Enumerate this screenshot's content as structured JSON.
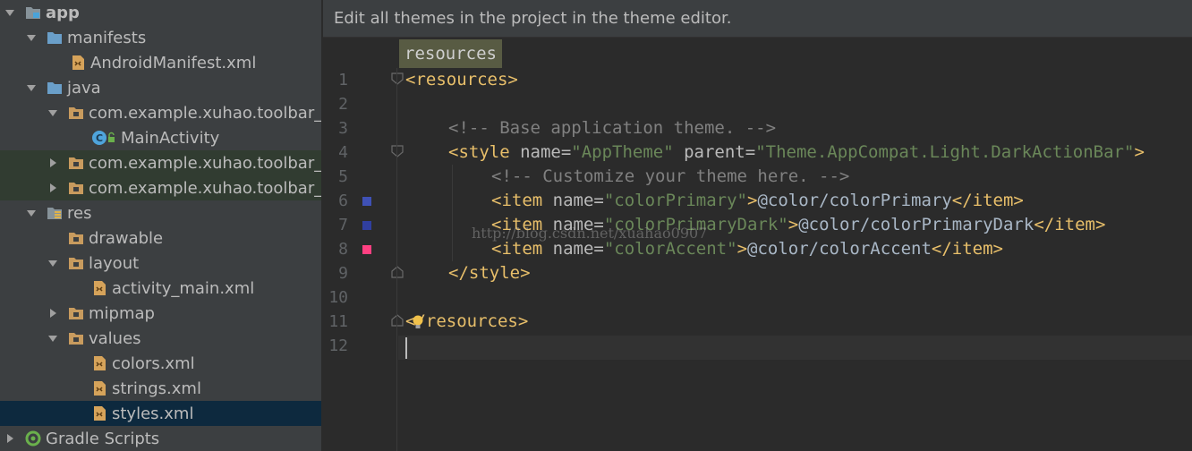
{
  "banner": {
    "text": "Edit all themes in the project in the theme editor."
  },
  "breadcrumb": {
    "label": "resources"
  },
  "tree": {
    "app": "app",
    "manifests": "manifests",
    "android_manifest": "AndroidManifest.xml",
    "java": "java",
    "pkg1": "com.example.xuhao.toolbar_di",
    "main_activity": "MainActivity",
    "pkg2": "com.example.xuhao.toolbar_di",
    "pkg3": "com.example.xuhao.toolbar_di",
    "res": "res",
    "drawable": "drawable",
    "layout": "layout",
    "activity_main": "activity_main.xml",
    "mipmap": "mipmap",
    "values": "values",
    "colors": "colors.xml",
    "strings": "strings.xml",
    "styles": "styles.xml",
    "gradle": "Gradle Scripts"
  },
  "gutter": {
    "numbers": [
      "1",
      "2",
      "3",
      "4",
      "5",
      "6",
      "7",
      "8",
      "9",
      "10",
      "11",
      "12"
    ]
  },
  "code": {
    "l1": {
      "t1": "<resources>"
    },
    "l3": {
      "c": "<!-- Base application theme. -->"
    },
    "l4": {
      "t1": "<style",
      "a1": " name=",
      "v1": "\"AppTheme\"",
      "a2": " parent=",
      "v2": "\"Theme.AppCompat.Light.DarkActionBar\"",
      "t2": ">"
    },
    "l5": {
      "c": "<!-- Customize your theme here. -->"
    },
    "l6": {
      "t1": "<item",
      "a1": " name=",
      "v1": "\"colorPrimary\"",
      "t2": ">",
      "txt": "@color/colorPrimary",
      "t3": "</item>"
    },
    "l7": {
      "t1": "<item",
      "a1": " name=",
      "v1": "\"colorPrimaryDark\"",
      "t2": ">",
      "txt": "@color/colorPrimaryDark",
      "t3": "</item>"
    },
    "l8": {
      "t1": "<item",
      "a1": " name=",
      "v1": "\"colorAccent\"",
      "t2": ">",
      "txt": "@color/colorAccent",
      "t3": "</item>"
    },
    "l9": {
      "t1": "</style>"
    },
    "l11": {
      "t1": "</resources>"
    }
  },
  "swatches": {
    "primary": "#3F51B5",
    "primary_dark": "#303F9F",
    "accent": "#FF4081"
  },
  "watermark": "http://blog.csdn.net/xuahao0907",
  "colors": {
    "tree_bg": "#3c3f41",
    "editor_bg": "#2b2b2b",
    "selection": "#0d293e",
    "tag": "#e8bf6a",
    "value": "#6a8759",
    "comment": "#808080"
  }
}
